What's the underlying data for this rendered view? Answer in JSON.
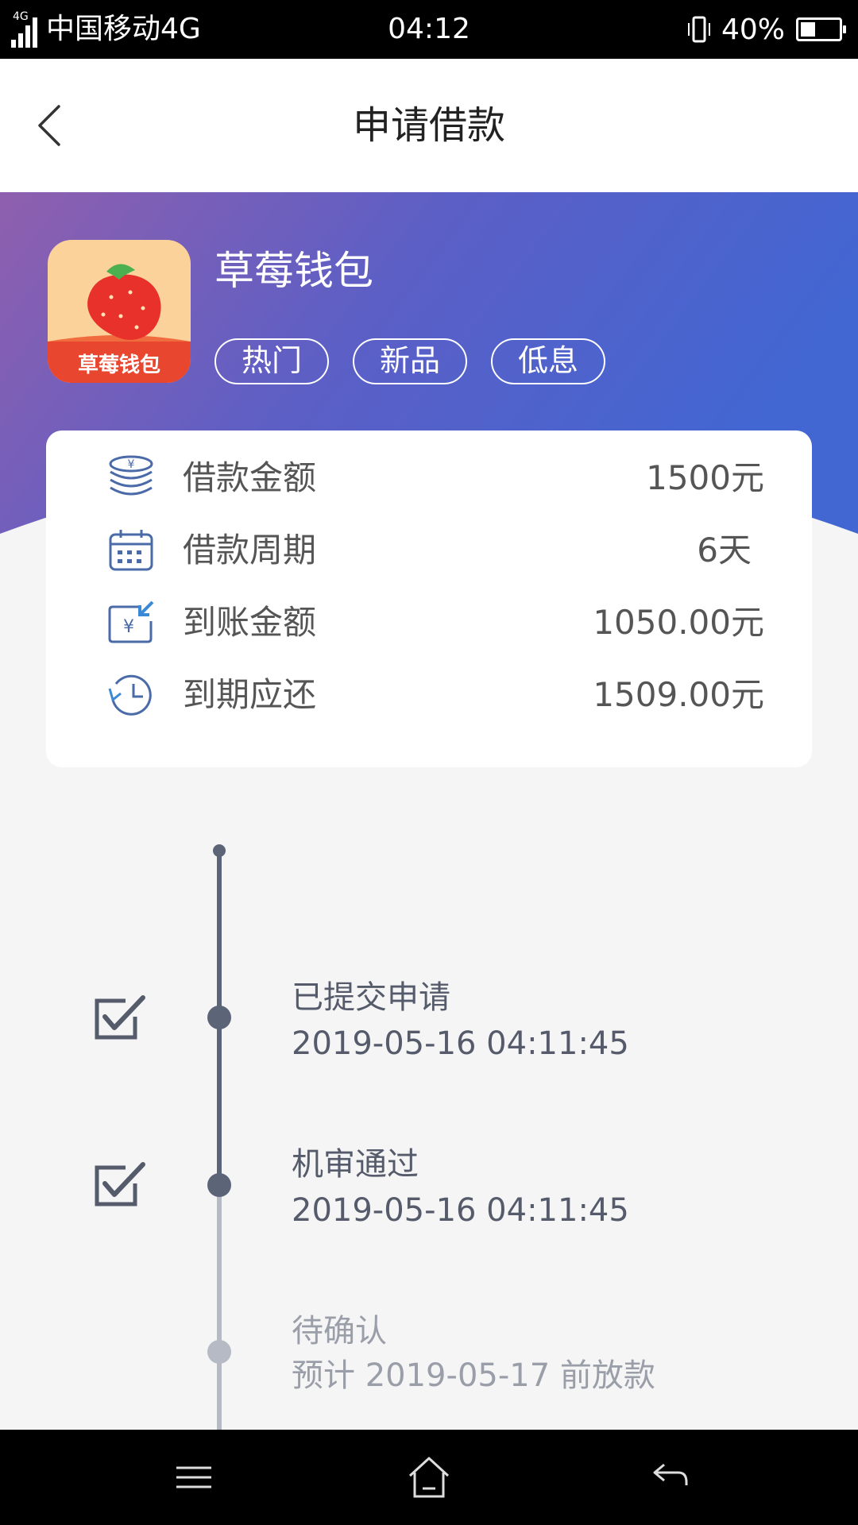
{
  "status_bar": {
    "network": "4G",
    "carrier": "中国移动4G",
    "time": "04:12",
    "battery_percent": "40%",
    "battery_level": 0.4
  },
  "header": {
    "title": "申请借款",
    "back_icon": "chevron-left-icon"
  },
  "app": {
    "name": "草莓钱包",
    "logo_text": "草莓钱包",
    "tags": [
      "热门",
      "新品",
      "低息"
    ]
  },
  "loan_info": {
    "rows": [
      {
        "icon": "coins-icon",
        "label": "借款金额",
        "value": "1500元"
      },
      {
        "icon": "calendar-icon",
        "label": "借款周期",
        "value": "6天"
      },
      {
        "icon": "money-in-icon",
        "label": "到账金额",
        "value": "1050.00元"
      },
      {
        "icon": "clock-return-icon",
        "label": "到期应还",
        "value": "1509.00元"
      }
    ]
  },
  "timeline": {
    "steps": [
      {
        "title": "已提交申请",
        "subtitle": "2019-05-16 04:11:45",
        "status": "done"
      },
      {
        "title": "机审通过",
        "subtitle": "2019-05-16 04:11:45",
        "status": "done"
      },
      {
        "title": "待确认",
        "subtitle": "预计 2019-05-17 前放款",
        "status": "pending"
      }
    ]
  },
  "bottom_nav": {
    "items": [
      "menu-icon",
      "home-icon",
      "back-arrow-icon"
    ]
  },
  "colors": {
    "banner_start": "#8f5fae",
    "banner_end": "#4a66cf",
    "timeline_done": "#5c6478",
    "timeline_pending": "#b5bac5",
    "icon_blue": "#4a6aa8"
  }
}
